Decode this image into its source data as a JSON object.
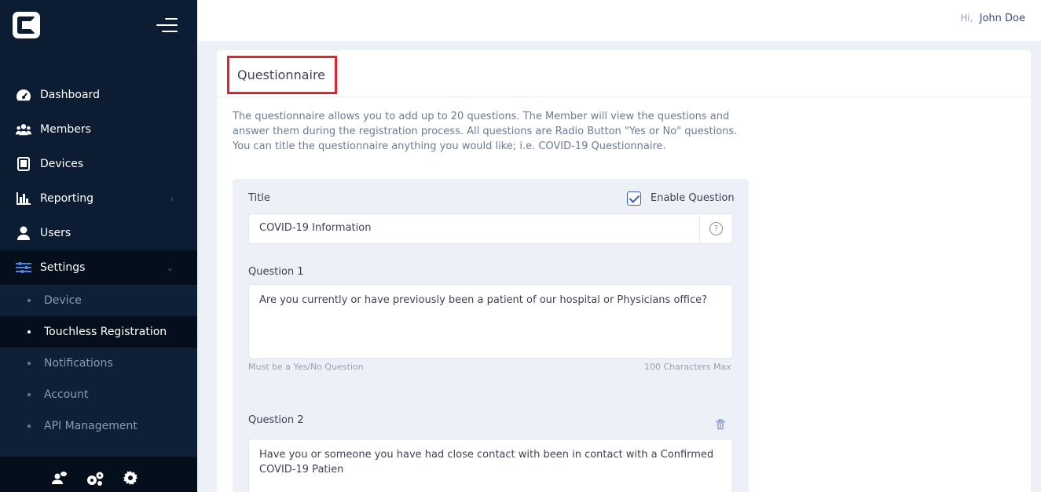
{
  "header": {
    "greeting_prefix": "Hi,",
    "user_name": "John Doe"
  },
  "sidebar": {
    "items": [
      {
        "label": "Dashboard",
        "icon": "speedometer-icon"
      },
      {
        "label": "Members",
        "icon": "users-icon"
      },
      {
        "label": "Devices",
        "icon": "tablet-icon"
      },
      {
        "label": "Reporting",
        "icon": "bar-chart-icon"
      },
      {
        "label": "Users",
        "icon": "user-icon"
      },
      {
        "label": "Settings",
        "icon": "sliders-icon"
      }
    ],
    "sub_items": [
      {
        "label": "Device"
      },
      {
        "label": "Touchless Registration"
      },
      {
        "label": "Notifications"
      },
      {
        "label": "Account"
      },
      {
        "label": "API Management"
      }
    ]
  },
  "page": {
    "title": "Questionnaire",
    "description": "The questionnaire allows you to add up to 20 questions. The Member will view the questions and answer them during the registration process. All questions are Radio Button \"Yes or No\" questions. You can title the questionnaire anything you would like; i.e. COVID-19 Questionnaire.",
    "form": {
      "title_label": "Title",
      "enable_label": "Enable Question",
      "enabled": true,
      "title_value": "COVID-19 Information",
      "questions": [
        {
          "label": "Question 1",
          "value": "Are you currently or have previously been a patient of our hospital or Physicians office?",
          "hint": "Must be a Yes/No Question",
          "max_hint": "100 Characters Max"
        },
        {
          "label": "Question 2",
          "value": "Have you or someone you have had close contact with been in contact with a Confirmed COVID-19 Patien"
        }
      ]
    }
  },
  "colors": {
    "sidebar_bg": "#0c1d33",
    "accent": "#3a5cc9",
    "highlight_border": "#e5212b"
  }
}
